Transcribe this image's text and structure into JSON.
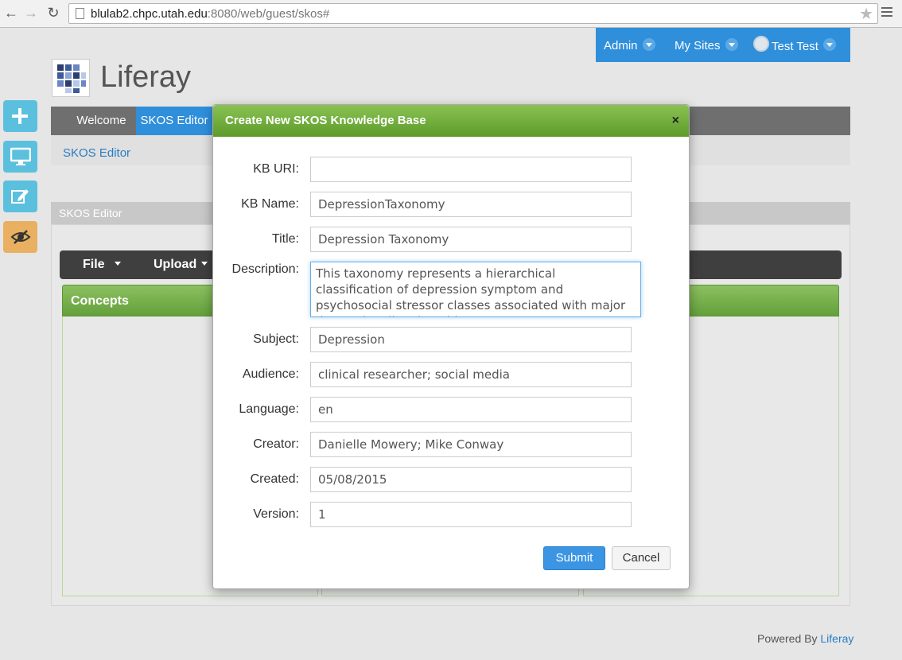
{
  "browser": {
    "url_host": "blulab2.chpc.utah.edu",
    "url_path": ":8080/web/guest/skos#"
  },
  "dock": {
    "admin": "Admin",
    "my_sites": "My Sites",
    "user": "Test Test"
  },
  "logo": {
    "name": "Liferay"
  },
  "nav": {
    "items": [
      "Welcome",
      "SKOS Editor"
    ]
  },
  "breadcrumb": "SKOS Editor",
  "portlet": {
    "title": "SKOS Editor",
    "menu": [
      "File",
      "Upload"
    ],
    "concepts_header": "Concepts"
  },
  "footer": {
    "powered_by": "Powered By",
    "brand": "Liferay"
  },
  "modal": {
    "title": "Create New SKOS Knowledge Base",
    "close": "×",
    "fields": [
      {
        "label": "KB URI:",
        "value": ""
      },
      {
        "label": "KB Name:",
        "value": "DepressionTaxonomy"
      },
      {
        "label": "Title:",
        "value": "Depression Taxonomy"
      },
      {
        "label": "Description:",
        "value": "This taxonomy represents a hierarchical classification of depression symptom and psychosocial stressor classes associated with major depressive disorder. This"
      },
      {
        "label": "Subject:",
        "value": "Depression"
      },
      {
        "label": "Audience:",
        "value": "clinical researcher; social media"
      },
      {
        "label": "Language:",
        "value": "en"
      },
      {
        "label": "Creator:",
        "value": "Danielle Mowery; Mike Conway"
      },
      {
        "label": "Created:",
        "value": "05/08/2015"
      },
      {
        "label": "Version:",
        "value": "1"
      }
    ],
    "submit": "Submit",
    "cancel": "Cancel"
  },
  "colors": {
    "dock": "#2f8fdb",
    "modal_header": "#6aa83a",
    "submit": "#3c95e3"
  }
}
